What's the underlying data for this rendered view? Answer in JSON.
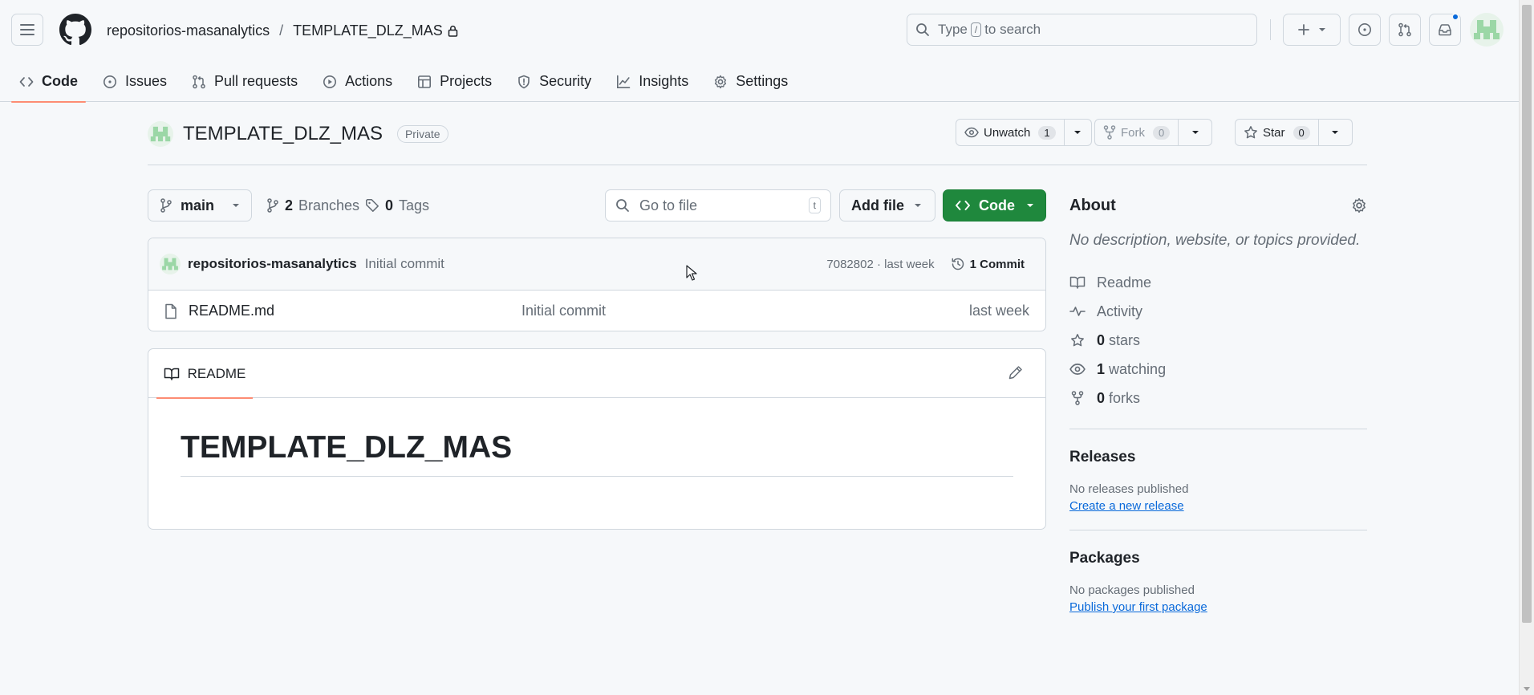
{
  "header": {
    "owner": "repositorios-masanalytics",
    "separator": "/",
    "repo": "TEMPLATE_DLZ_MAS",
    "search": {
      "prefix": "Type",
      "key": "/",
      "suffix": "to search"
    }
  },
  "nav": [
    {
      "label": "Code",
      "icon": "code-icon",
      "active": true
    },
    {
      "label": "Issues",
      "icon": "issue-opened-icon"
    },
    {
      "label": "Pull requests",
      "icon": "git-pull-request-icon"
    },
    {
      "label": "Actions",
      "icon": "play-icon"
    },
    {
      "label": "Projects",
      "icon": "table-icon"
    },
    {
      "label": "Security",
      "icon": "shield-icon"
    },
    {
      "label": "Insights",
      "icon": "graph-icon"
    },
    {
      "label": "Settings",
      "icon": "gear-icon"
    }
  ],
  "repo_header": {
    "name": "TEMPLATE_DLZ_MAS",
    "visibility": "Private",
    "watch": {
      "label": "Unwatch",
      "count": "1"
    },
    "fork": {
      "label": "Fork",
      "count": "0"
    },
    "star": {
      "label": "Star",
      "count": "0"
    }
  },
  "toolbar": {
    "branch": "main",
    "branches_count": "2",
    "branches_label": "Branches",
    "tags_count": "0",
    "tags_label": "Tags",
    "goto_placeholder": "Go to file",
    "goto_key": "t",
    "add_file": "Add file",
    "code": "Code"
  },
  "latest_commit": {
    "author": "repositorios-masanalytics",
    "message": "Initial commit",
    "sha_time": "7082802 · last week",
    "commits": "1 Commit"
  },
  "files": [
    {
      "name": "README.md",
      "message": "Initial commit",
      "date": "last week"
    }
  ],
  "readme": {
    "tab": "README",
    "heading": "TEMPLATE_DLZ_MAS"
  },
  "about": {
    "title": "About",
    "description": "No description, website, or topics provided.",
    "items": [
      {
        "icon": "book-icon",
        "bold": "",
        "text": "Readme"
      },
      {
        "icon": "pulse-icon",
        "bold": "",
        "text": "Activity"
      },
      {
        "icon": "star-icon",
        "bold": "0",
        "text": "stars"
      },
      {
        "icon": "eye-icon",
        "bold": "1",
        "text": "watching"
      },
      {
        "icon": "repo-forked-icon",
        "bold": "0",
        "text": "forks"
      }
    ],
    "releases": {
      "title": "Releases",
      "none": "No releases published",
      "link": "Create a new release"
    },
    "packages": {
      "title": "Packages",
      "none": "No packages published",
      "link": "Publish your first package"
    }
  },
  "colors": {
    "accent_underline": "#fd8c73",
    "primary_green": "#1f883d",
    "link_blue": "#0969da",
    "notification_dot": "#0969da"
  }
}
